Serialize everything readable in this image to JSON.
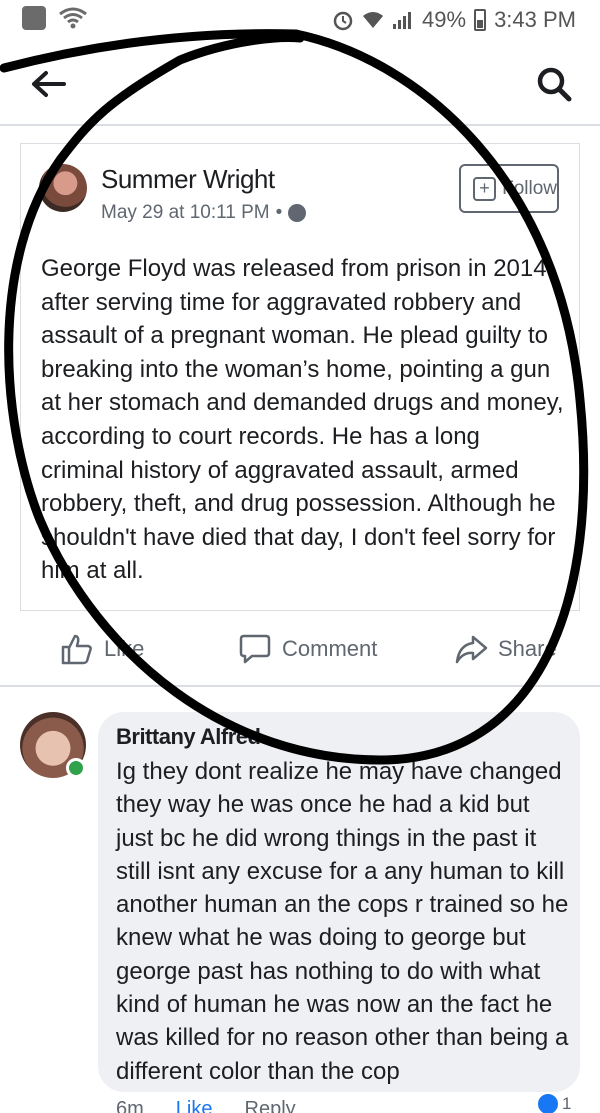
{
  "status_bar": {
    "battery": "49%",
    "time": "3:43 PM"
  },
  "post": {
    "author": "Summer Wright",
    "date": "May 29 at 10:11 PM",
    "separator": "•",
    "follow_label": "Follow",
    "body": "George Floyd was released from prison in 2014 after serving time for aggravated robbery and assault of a pregnant woman. He plead guilty to breaking into the woman’s home, pointing a gun at her stomach and demanded drugs and money, according to court records.   He has a long criminal history of aggravated assault, armed robbery, theft, and drug possession.    Although he shouldn't have died that day, I don't feel sorry for him at all."
  },
  "actions": {
    "like": "Like",
    "comment": "Comment",
    "share": "Share"
  },
  "comment": {
    "author": "Brittany Alfred",
    "text": "Ig they dont realize he may have changed they way he was once he had a kid but just bc he did wrong things in the past it still isnt any excuse for a any human to kill another human an the cops r trained so he knew what he was doing to george but george past has nothing to do with what kind of human he was now an the fact he was killed for no reason other than being a different color than the cop",
    "time": "6m",
    "like_label": "Like",
    "reply_label": "Reply",
    "reaction_count": "1"
  },
  "colors": {
    "accent": "#1877f2",
    "secondary_text": "#606770",
    "bubble": "#eff0f3",
    "online": "#31a24c"
  },
  "icons": [
    "notification-square-icon",
    "wifi-icon",
    "alarm-icon",
    "signal-icon",
    "battery-icon",
    "back-arrow-icon",
    "search-icon",
    "globe-icon",
    "follow-plus-icon",
    "thumbs-up-icon",
    "comment-bubble-icon",
    "share-arrow-icon",
    "like-reaction-icon"
  ]
}
